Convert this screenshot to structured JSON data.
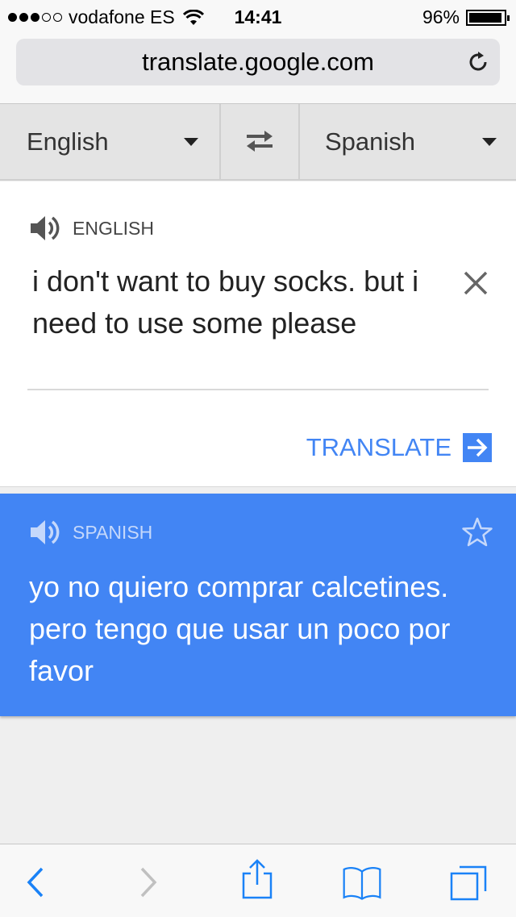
{
  "status_bar": {
    "carrier": "vodafone ES",
    "time": "14:41",
    "battery": "96%",
    "battery_level": 0.96
  },
  "browser": {
    "url": "translate.google.com"
  },
  "language_bar": {
    "source_language": "English",
    "target_language": "Spanish"
  },
  "input_card": {
    "heading": "ENGLISH",
    "source_text": "i don't want to buy socks. but i need to use some please",
    "translate_label": "TRANSLATE"
  },
  "output_card": {
    "heading": "SPANISH",
    "translated_text": "yo no quiero comprar calcetines. pero tengo que usar un poco por favor"
  },
  "icons": {
    "reload": "reload-icon",
    "swap": "swap-languages-icon",
    "speaker": "speaker-icon",
    "clear": "close-icon",
    "translate_arrow": "arrow-right-icon",
    "star": "star-icon",
    "back": "chevron-left-icon",
    "forward": "chevron-right-icon",
    "share": "share-icon",
    "bookmarks": "book-icon",
    "tabs": "tabs-icon"
  },
  "colors": {
    "accent": "#4285f4",
    "ios_blue": "#1a82f7"
  }
}
